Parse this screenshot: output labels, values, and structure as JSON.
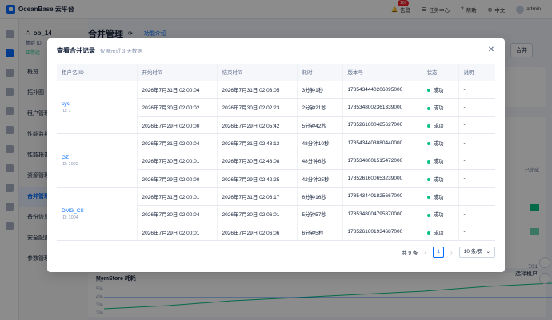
{
  "topbar": {
    "brand": "OceanBase 云平台",
    "alert_label": "告警",
    "alert_count": "167",
    "task_label": "任务中心",
    "help_label": "帮助",
    "lang_label": "中文",
    "user_label": "admin"
  },
  "sidebar": {
    "cluster_name": "ob_14",
    "cluster_id_label": "集群 ID:",
    "status": "正常运",
    "items": [
      {
        "label": "概览"
      },
      {
        "label": "拓扑图"
      },
      {
        "label": "租户管理"
      },
      {
        "label": "性能监控"
      },
      {
        "label": "性能报告"
      },
      {
        "label": "资源管理"
      },
      {
        "label": "合并管理"
      },
      {
        "label": "备份恢复"
      },
      {
        "label": "安全配置"
      },
      {
        "label": "参数管理"
      }
    ]
  },
  "main": {
    "title": "合并管理",
    "func_link": "功能介绍",
    "merge_button": "合并",
    "done_label": "已完成",
    "chart_title": "MemStore 耗耗",
    "date_label": "7/31",
    "select_tenant": "选择租户",
    "y_ticks": [
      "6%",
      "5%",
      "4%",
      "3%",
      "2%"
    ]
  },
  "modal": {
    "title": "查看合并记录",
    "subtitle": "仅展示近 3 天数据",
    "close_icon": "close-icon",
    "columns": [
      "租户名/ID",
      "开始时间",
      "结束时间",
      "耗时",
      "版本号",
      "状态",
      "说明"
    ],
    "tenants": [
      {
        "name": "sys",
        "id": "ID: 1"
      },
      {
        "name": "GZ",
        "id": "ID: 1002"
      },
      {
        "name": "DMG_CS",
        "id": "ID: 1004"
      }
    ],
    "rows": [
      {
        "start": "2026年7月31日 02:00:04",
        "end": "2026年7月31日 02:03:05",
        "dur": "3分钟1秒",
        "ver": "1785434440206095000",
        "status": "成功",
        "note": "-"
      },
      {
        "start": "2026年7月30日 02:00:02",
        "end": "2026年7月30日 02:02:23",
        "dur": "2分钟21秒",
        "ver": "1785348002361339000",
        "status": "成功",
        "note": "-"
      },
      {
        "start": "2026年7月29日 02:00:00",
        "end": "2026年7月29日 02:05:42",
        "dur": "5分钟42秒",
        "ver": "1785261600485627000",
        "status": "成功",
        "note": "-"
      },
      {
        "start": "2026年7月31日 02:00:04",
        "end": "2026年7月31日 02:48:13",
        "dur": "48分钟10秒",
        "ver": "1785434403880440000",
        "status": "成功",
        "note": "-"
      },
      {
        "start": "2026年7月30日 02:00:01",
        "end": "2026年7月30日 02:48:08",
        "dur": "48分钟6秒",
        "ver": "1785348001515472000",
        "status": "成功",
        "note": "-"
      },
      {
        "start": "2026年7月29日 02:00:00",
        "end": "2026年7月29日 02:42:25",
        "dur": "42分钟25秒",
        "ver": "1785261600653239000",
        "status": "成功",
        "note": "-"
      },
      {
        "start": "2026年7月31日 02:00:01",
        "end": "2026年7月31日 02:06:17",
        "dur": "6分钟16秒",
        "ver": "1785434401825667000",
        "status": "成功",
        "note": "-"
      },
      {
        "start": "2026年7月30日 02:00:04",
        "end": "2026年7月30日 02:06:01",
        "dur": "5分钟57秒",
        "ver": "1785348004795870000",
        "status": "成功",
        "note": "-"
      },
      {
        "start": "2026年7月29日 02:00:01",
        "end": "2026年7月29日 02:06:06",
        "dur": "6分钟5秒",
        "ver": "1785261601934687000",
        "status": "成功",
        "note": "-"
      }
    ],
    "pager": {
      "total": "共 9 条",
      "current_page": "1",
      "page_size": "10 条/页"
    }
  },
  "colors": {
    "primary": "#006aff",
    "success": "#0ac185",
    "overlay": "rgba(0,0,0,0.45)"
  }
}
